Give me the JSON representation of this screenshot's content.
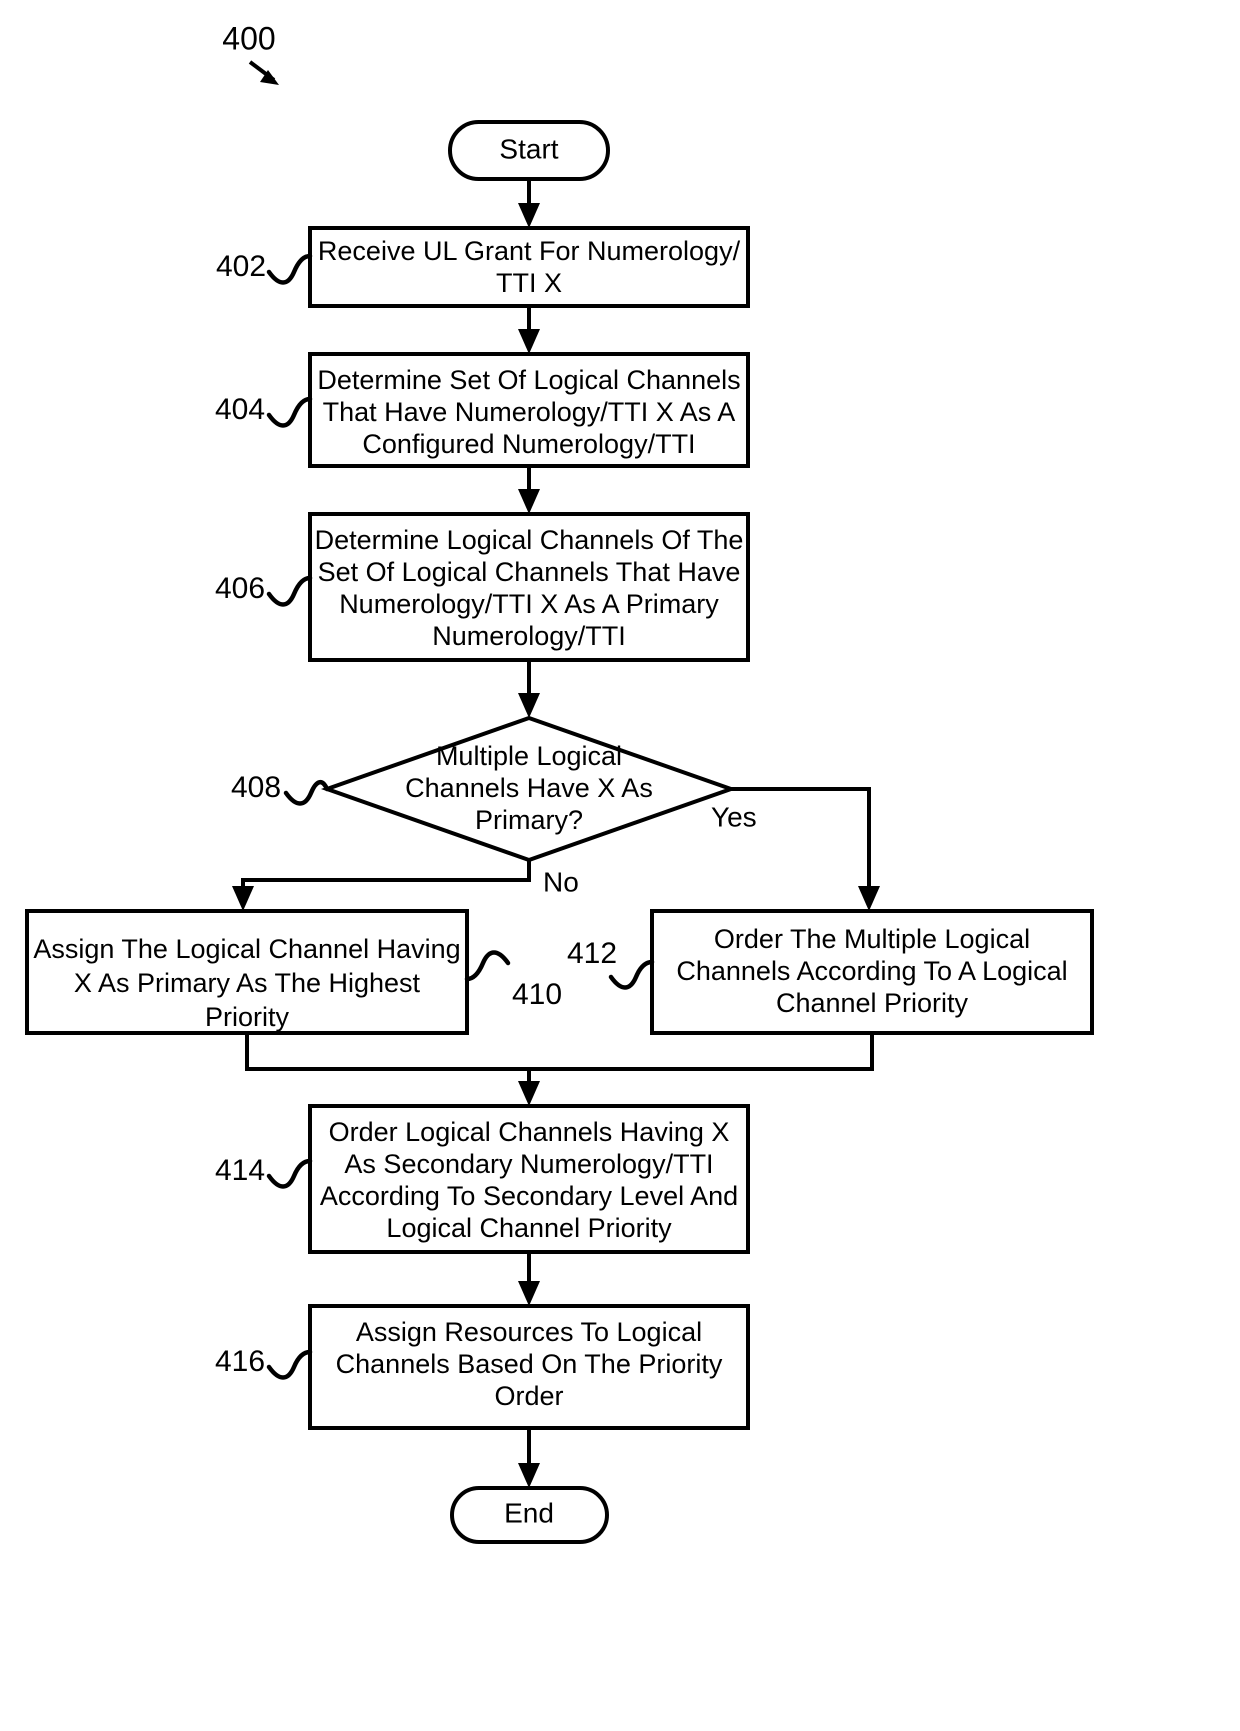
{
  "figure": {
    "number": "400",
    "type": "flowchart"
  },
  "terminators": {
    "start": "Start",
    "end": "End"
  },
  "branch_labels": {
    "yes": "Yes",
    "no": "No"
  },
  "steps": [
    {
      "ref": "402",
      "ref_side": "left",
      "lines": [
        "Receive UL Grant For Numerology/",
        "TTI X"
      ]
    },
    {
      "ref": "404",
      "ref_side": "left",
      "lines": [
        "Determine Set Of Logical Channels",
        "That Have Numerology/TTI X As A",
        "Configured Numerology/TTI"
      ]
    },
    {
      "ref": "406",
      "ref_side": "left",
      "lines": [
        "Determine Logical Channels Of The",
        "Set Of Logical Channels That Have",
        "Numerology/TTI X As A Primary",
        "Numerology/TTI"
      ]
    },
    {
      "ref": "408",
      "ref_side": "left",
      "lines": [
        "Multiple Logical",
        "Channels Have X As",
        "Primary?"
      ]
    },
    {
      "ref": "410",
      "ref_side": "right",
      "lines": [
        "Assign The Logical Channel Having",
        "X As Primary As The Highest",
        "Priority"
      ]
    },
    {
      "ref": "412",
      "ref_side": "left",
      "lines": [
        "Order The Multiple Logical",
        "Channels According To A Logical",
        "Channel Priority"
      ]
    },
    {
      "ref": "414",
      "ref_side": "left",
      "lines": [
        "Order Logical Channels Having X",
        "As Secondary Numerology/TTI",
        "According To Secondary Level And",
        "Logical Channel Priority"
      ]
    },
    {
      "ref": "416",
      "ref_side": "left",
      "lines": [
        "Assign Resources To Logical",
        "Channels Based On The Priority",
        "Order"
      ]
    }
  ]
}
